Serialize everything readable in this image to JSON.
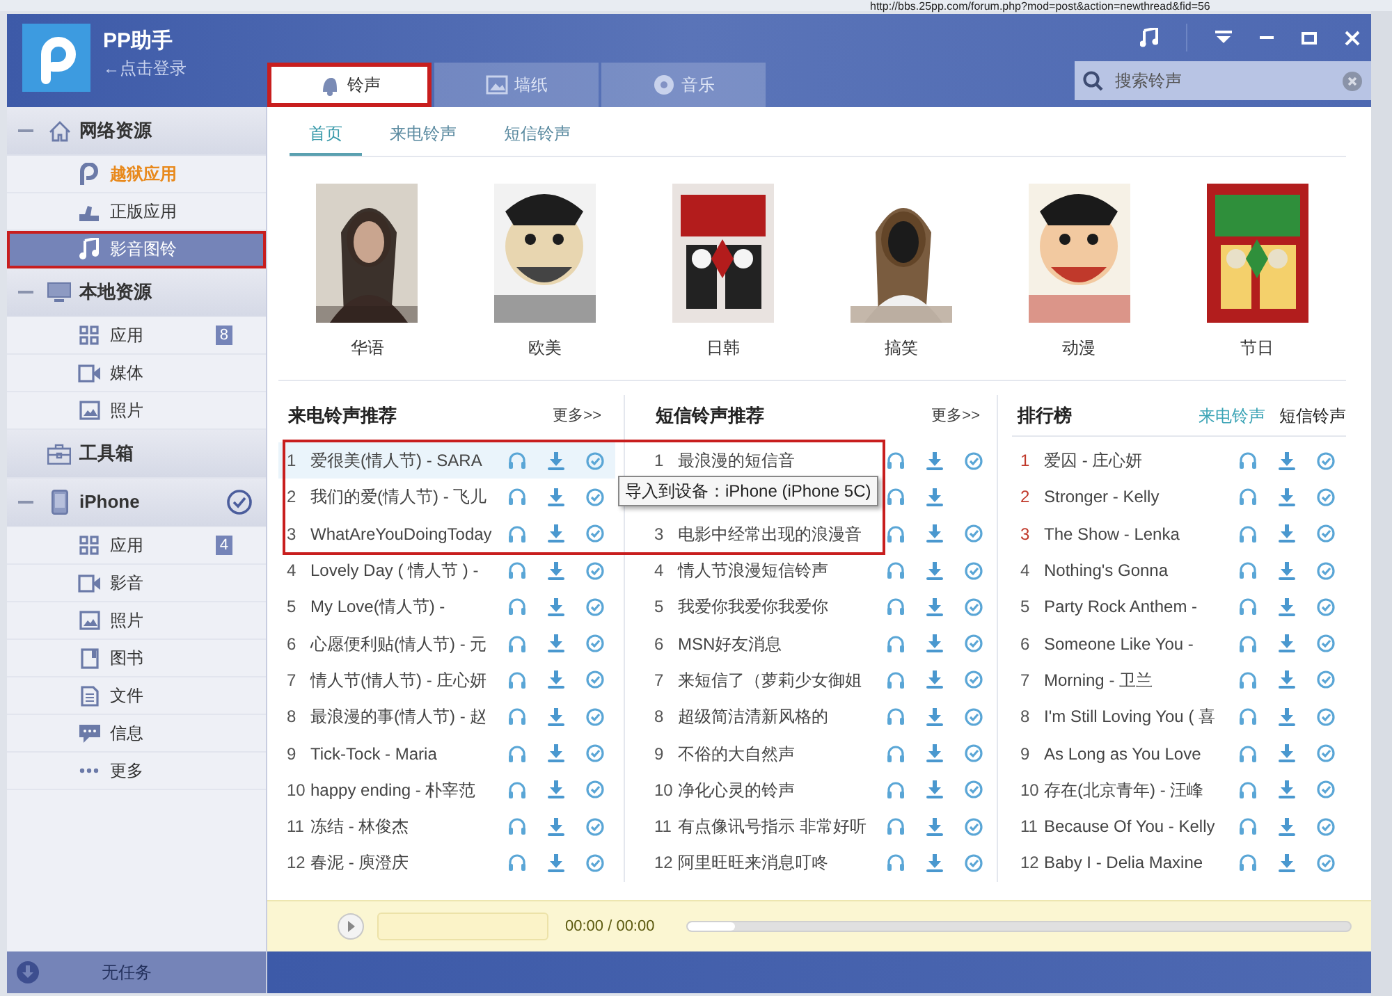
{
  "browser": {
    "address": "http://bbs.25pp.com/forum.php?mod=post&action=newthread&fid=56"
  },
  "app": {
    "title": "PP助手",
    "login": "←点击登录"
  },
  "tabs": [
    {
      "label": "铃声",
      "selected": true,
      "highlighted": true
    },
    {
      "label": "墙纸",
      "selected": false,
      "highlighted": false
    },
    {
      "label": "音乐",
      "selected": false,
      "highlighted": false
    }
  ],
  "search": {
    "placeholder": "搜索铃声"
  },
  "sidebar": {
    "groups": [
      {
        "label": "网络资源",
        "expanded": true,
        "checked": false,
        "children": [
          {
            "label": "越狱应用",
            "kind": "promo",
            "selected": false
          },
          {
            "label": "正版应用",
            "kind": "normal",
            "selected": false
          },
          {
            "label": "影音图铃",
            "kind": "normal",
            "selected": true,
            "highlighted": true
          }
        ]
      },
      {
        "label": "本地资源",
        "expanded": true,
        "checked": false,
        "children": [
          {
            "label": "应用",
            "kind": "normal",
            "selected": false,
            "badge": "8"
          },
          {
            "label": "媒体",
            "kind": "normal",
            "selected": false
          },
          {
            "label": "照片",
            "kind": "normal",
            "selected": false
          }
        ]
      },
      {
        "label": "工具箱",
        "expanded": false,
        "checked": false
      },
      {
        "label": "iPhone",
        "expanded": true,
        "checked": true,
        "children": [
          {
            "label": "应用",
            "kind": "normal",
            "selected": false,
            "badge": "4"
          },
          {
            "label": "影音",
            "kind": "normal",
            "selected": false
          },
          {
            "label": "照片",
            "kind": "normal",
            "selected": false
          },
          {
            "label": "图书",
            "kind": "normal",
            "selected": false
          },
          {
            "label": "文件",
            "kind": "normal",
            "selected": false
          },
          {
            "label": "信息",
            "kind": "normal",
            "selected": false
          },
          {
            "label": "更多",
            "kind": "normal",
            "selected": false
          }
        ]
      }
    ]
  },
  "status": "无任务",
  "subtabs": [
    {
      "label": "首页",
      "selected": true
    },
    {
      "label": "来电铃声",
      "selected": false
    },
    {
      "label": "短信铃声",
      "selected": false
    }
  ],
  "categories": [
    {
      "label": "华语",
      "kind": "picture"
    },
    {
      "label": "欧美",
      "kind": "picture"
    },
    {
      "label": "日韩",
      "kind": "picture"
    },
    {
      "label": "搞笑",
      "kind": "picture"
    },
    {
      "label": "动漫",
      "kind": "picture"
    },
    {
      "label": "节日",
      "kind": "picture"
    }
  ],
  "call_list": {
    "title": "来电铃声推荐",
    "more": "更多>>",
    "rows": [
      {
        "num": "1",
        "title": "爱很美(情人节) - SARA",
        "selected": true
      },
      {
        "num": "2",
        "title": "我们的爱(情人节) - 飞儿",
        "selected": false
      },
      {
        "num": "3",
        "title": "WhatAreYouDoingToday",
        "selected": false
      },
      {
        "num": "4",
        "title": "Lovely Day ( 情人节 ) -",
        "selected": false
      },
      {
        "num": "5",
        "title": "My Love(情人节) -",
        "selected": false
      },
      {
        "num": "6",
        "title": "心愿便利贴(情人节) - 元",
        "selected": false
      },
      {
        "num": "7",
        "title": "情人节(情人节) - 庄心妍",
        "selected": false
      },
      {
        "num": "8",
        "title": "最浪漫的事(情人节) - 赵",
        "selected": false
      },
      {
        "num": "9",
        "title": "Tick-Tock - Maria",
        "selected": false
      },
      {
        "num": "10",
        "title": "happy ending - 朴宰范",
        "selected": false
      },
      {
        "num": "11",
        "title": "冻结 - 林俊杰",
        "selected": false
      },
      {
        "num": "12",
        "title": "春泥 - 庾澄庆",
        "selected": false
      }
    ]
  },
  "list_annotation": {
    "kind": "frame"
  },
  "sms_list": {
    "title": "短信铃声推荐",
    "more": "更多>>",
    "rows": [
      {
        "num": "1",
        "title": "最浪漫的短信音",
        "kind": "row"
      },
      {
        "kind": "covered"
      },
      {
        "num": "3",
        "title": "电影中经常出现的浪漫音",
        "kind": "row"
      },
      {
        "num": "4",
        "title": "情人节浪漫短信铃声",
        "kind": "row"
      },
      {
        "num": "5",
        "title": "我爱你我爱你我爱你",
        "kind": "row"
      },
      {
        "num": "6",
        "title": "MSN好友消息",
        "kind": "row"
      },
      {
        "num": "7",
        "title": "来短信了（萝莉少女御姐",
        "kind": "row"
      },
      {
        "num": "8",
        "title": "超级简洁清新风格的",
        "kind": "row"
      },
      {
        "num": "9",
        "title": "不俗的大自然声",
        "kind": "row"
      },
      {
        "num": "10",
        "title": "净化心灵的铃声",
        "kind": "row"
      },
      {
        "num": "11",
        "title": "有点像讯号指示 非常好听",
        "kind": "row"
      },
      {
        "num": "12",
        "title": "阿里旺旺来消息叮咚",
        "kind": "row"
      }
    ]
  },
  "tooltip": "导入到设备：iPhone (iPhone 5C)",
  "ranking": {
    "title": "排行榜",
    "tabs": [
      {
        "label": "来电铃声",
        "selected": true
      },
      {
        "label": "短信铃声",
        "selected": false
      }
    ],
    "rows": [
      {
        "num": "1",
        "title": "爱囚 - 庄心妍",
        "color": "#c0392b"
      },
      {
        "num": "2",
        "title": "Stronger - Kelly",
        "color": "#c0392b"
      },
      {
        "num": "3",
        "title": "The Show - Lenka",
        "color": "#c0392b"
      },
      {
        "num": "4",
        "title": "Nothing's Gonna",
        "color": "#555555"
      },
      {
        "num": "5",
        "title": "Party Rock Anthem -",
        "color": "#555555"
      },
      {
        "num": "6",
        "title": "Someone Like You -",
        "color": "#555555"
      },
      {
        "num": "7",
        "title": "Morning - 卫兰",
        "color": "#555555"
      },
      {
        "num": "8",
        "title": "I'm Still Loving You ( 喜",
        "color": "#555555"
      },
      {
        "num": "9",
        "title": "As Long as You Love",
        "color": "#555555"
      },
      {
        "num": "10",
        "title": "存在(北京青年) - 汪峰",
        "color": "#555555"
      },
      {
        "num": "11",
        "title": "Because Of You - Kelly",
        "color": "#555555"
      },
      {
        "num": "12",
        "title": "Baby I - Delia Maxine",
        "color": "#555555"
      }
    ]
  },
  "player": {
    "time": "00:00 / 00:00",
    "level": 0.07
  }
}
